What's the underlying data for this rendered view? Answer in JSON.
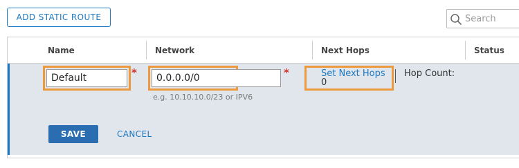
{
  "toolbar": {
    "add_label": "ADD STATIC ROUTE",
    "search_placeholder": "Search"
  },
  "grid": {
    "columns": [
      "Name",
      "Network",
      "Next Hops",
      "Status"
    ],
    "edit_row": {
      "name_value": "Default",
      "network_value": "0.0.0.0/0",
      "network_hint": "e.g. 10.10.10.0/23 or IPV6",
      "required_mark": "*",
      "set_next_hops_label": "Set Next Hops",
      "hop_count_label": "Hop Count:",
      "hop_count_value": "0",
      "save_label": "SAVE",
      "cancel_label": "CANCEL"
    }
  },
  "colors": {
    "accent_blue": "#1d79c2",
    "highlight_orange": "#ec9a3d",
    "required_red": "#d6342b",
    "edit_row_bg": "#e0e6ec"
  }
}
